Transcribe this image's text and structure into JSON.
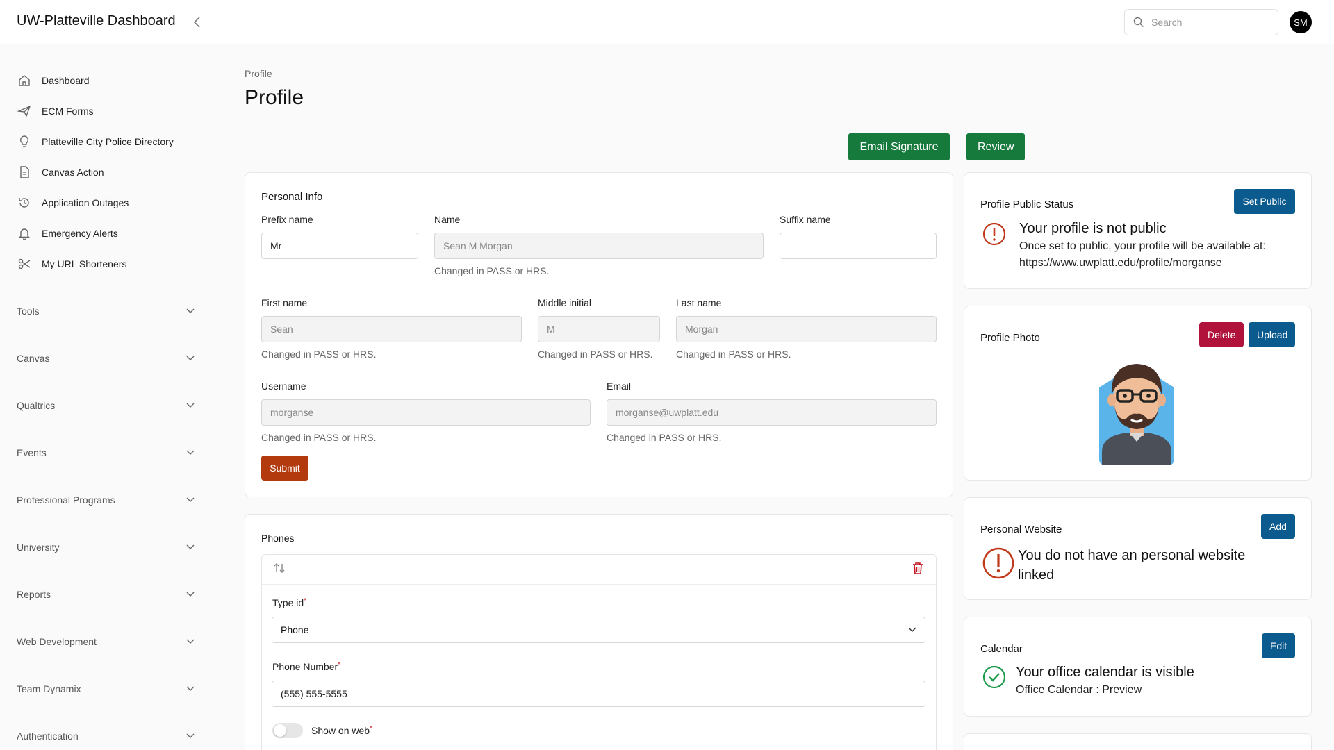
{
  "header": {
    "app_title": "UW-Platteville Dashboard",
    "search_placeholder": "Search",
    "avatar_initials": "SM"
  },
  "sidebar": {
    "items": [
      {
        "label": "Dashboard",
        "icon": "home-icon"
      },
      {
        "label": "ECM Forms",
        "icon": "plane-icon"
      },
      {
        "label": "Platteville City Police Directory",
        "icon": "lightbulb-icon"
      },
      {
        "label": "Canvas Action",
        "icon": "document-icon"
      },
      {
        "label": "Application Outages",
        "icon": "history-icon"
      },
      {
        "label": "Emergency Alerts",
        "icon": "bell-icon"
      },
      {
        "label": "My URL Shorteners",
        "icon": "scissors-icon"
      }
    ],
    "groups": [
      {
        "label": "Tools"
      },
      {
        "label": "Canvas"
      },
      {
        "label": "Qualtrics"
      },
      {
        "label": "Events"
      },
      {
        "label": "Professional Programs"
      },
      {
        "label": "University"
      },
      {
        "label": "Reports"
      },
      {
        "label": "Web Development"
      },
      {
        "label": "Team Dynamix"
      },
      {
        "label": "Authentication"
      }
    ]
  },
  "main": {
    "breadcrumb": "Profile",
    "title": "Profile",
    "email_signature_label": "Email Signature",
    "review_label": "Review"
  },
  "personal_info": {
    "title": "Personal Info",
    "prefix_label": "Prefix name",
    "prefix_value": "Mr",
    "name_label": "Name",
    "name_value": "Sean M Morgan",
    "suffix_label": "Suffix name",
    "suffix_value": "",
    "first_label": "First name",
    "first_value": "Sean",
    "middle_label": "Middle initial",
    "middle_value": "M",
    "last_label": "Last name",
    "last_value": "Morgan",
    "username_label": "Username",
    "username_value": "morganse",
    "email_label": "Email",
    "email_value": "morganse@uwplatt.edu",
    "helper": "Changed in PASS or HRS.",
    "submit_label": "Submit"
  },
  "phones": {
    "title": "Phones",
    "type_label": "Type id",
    "type_value": "Phone",
    "number_label": "Phone Number",
    "number_value": "(555) 555-5555",
    "show_on_web_label": "Show on web",
    "show_on_web": false
  },
  "public_status": {
    "title": "Profile Public Status",
    "button": "Set Public",
    "heading": "Your profile is not public",
    "line1": "Once set to public, your profile will be available at:",
    "url": "https://www.uwplatt.edu/profile/morganse"
  },
  "profile_photo": {
    "title": "Profile Photo",
    "delete_label": "Delete",
    "upload_label": "Upload"
  },
  "personal_website": {
    "title": "Personal Website",
    "button": "Add",
    "heading_line1": "You do not have an personal website",
    "heading_line2": "linked"
  },
  "calendar": {
    "title": "Calendar",
    "button": "Edit",
    "heading": "Your office calendar is visible",
    "subtext": "Office Calendar : Preview"
  },
  "colors": {
    "green_button": "#157a3c",
    "blue_button": "#0c5b8f",
    "red_button": "#b0123c",
    "submit_button": "#b33a0d",
    "warning": "#c0391b",
    "success": "#1d9a4a"
  }
}
